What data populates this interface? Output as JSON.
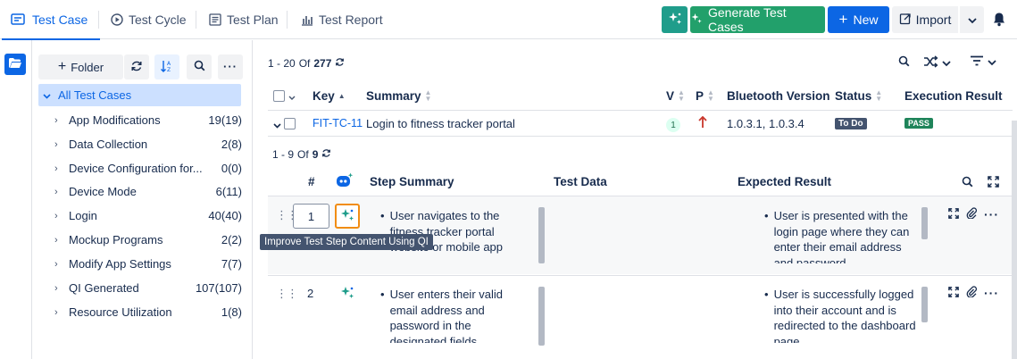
{
  "nav": {
    "tabs": [
      {
        "label": "Test Case",
        "icon": "test-case-icon"
      },
      {
        "label": "Test Cycle",
        "icon": "test-cycle-icon"
      },
      {
        "label": "Test Plan",
        "icon": "test-plan-icon"
      },
      {
        "label": "Test Report",
        "icon": "test-report-icon"
      }
    ],
    "generate_label": "Generate Test Cases",
    "new_label": "New",
    "import_label": "Import"
  },
  "folders": {
    "add_folder_label": "Folder",
    "root_label": "All Test Cases",
    "items": [
      {
        "name": "App Modifications",
        "count": "19(19)"
      },
      {
        "name": "Data Collection",
        "count": "2(8)"
      },
      {
        "name": "Device Configuration for...",
        "count": "0(0)"
      },
      {
        "name": "Device Mode",
        "count": "6(11)"
      },
      {
        "name": "Login",
        "count": "40(40)"
      },
      {
        "name": "Mockup Programs",
        "count": "2(2)"
      },
      {
        "name": "Modify App Settings",
        "count": "7(7)"
      },
      {
        "name": "QI Generated",
        "count": "107(107)"
      },
      {
        "name": "Resource Utilization",
        "count": "1(8)"
      }
    ]
  },
  "table": {
    "pager": {
      "range": "1 - 20",
      "of": "Of",
      "total": "277"
    },
    "columns": {
      "key": "Key",
      "summary": "Summary",
      "v": "V",
      "p": "P",
      "bluetooth": "Bluetooth Version",
      "status": "Status",
      "execution": "Execution Result"
    },
    "row": {
      "key": "FIT-TC-11",
      "summary": "Login to fitness tracker portal",
      "version": "1",
      "bluetooth": "1.0.3.1, 1.0.3.4",
      "status": "To Do",
      "execution": "PASS"
    }
  },
  "steps": {
    "pager": {
      "range": "1 - 9",
      "of": "Of",
      "total": "9"
    },
    "columns": {
      "num": "#",
      "summary": "Step Summary",
      "data": "Test Data",
      "expected": "Expected Result"
    },
    "rows": [
      {
        "num": "1",
        "summary": "User navigates to the fitness tracker portal website or mobile app",
        "expected": "User is presented with the login page where they can enter their email address and password"
      },
      {
        "num": "2",
        "summary": "User enters their valid email address and password in the designated fields",
        "expected": "User is successfully logged into their account and is redirected to the dashboard page"
      }
    ],
    "tooltip": "Improve Test Step Content Using QI"
  }
}
